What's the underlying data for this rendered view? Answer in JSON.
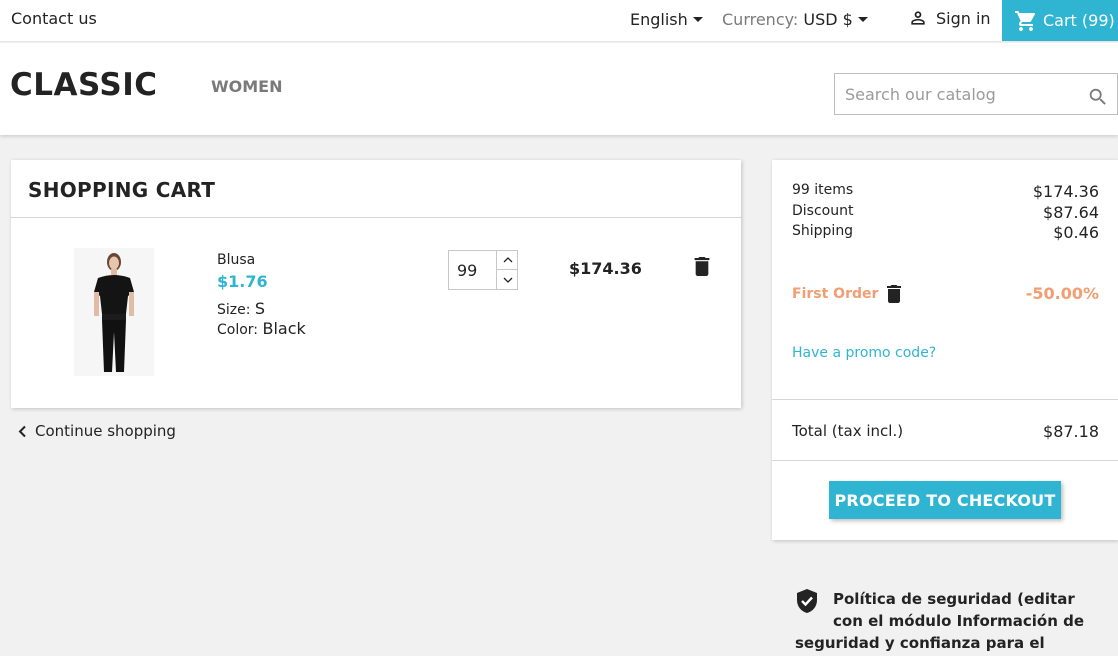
{
  "topnav": {
    "contact": "Contact us",
    "language": "English",
    "currency_label": "Currency:",
    "currency_value": "USD $",
    "signin": "Sign in",
    "cart": "Cart (99)"
  },
  "header": {
    "logo": "CLASSIC",
    "menu_women": "WOMEN",
    "search_placeholder": "Search our catalog"
  },
  "cart": {
    "title": "SHOPPING CART",
    "item": {
      "name": "Blusa",
      "price": "$1.76",
      "size_label": "Size:",
      "size": "S",
      "color_label": "Color:",
      "color": "Black",
      "quantity": "99",
      "line_total": "$174.36"
    },
    "continue": "Continue shopping"
  },
  "summary": {
    "items_label": "99 items",
    "items_value": "$174.36",
    "discount_label": "Discount",
    "discount_value": "$87.64",
    "shipping_label": "Shipping",
    "shipping_value": "$0.46",
    "voucher_name": "First Order",
    "voucher_value": "-50.00%",
    "promo": "Have a promo code?",
    "total_label": "Total (tax incl.)",
    "total_value": "$87.18",
    "checkout": "PROCEED TO CHECKOUT"
  },
  "reassurance": {
    "text": "Política de seguridad (editar con el módulo Información de seguridad y confianza para el cliente)"
  },
  "colors": {
    "accent": "#2fb5d2",
    "voucher": "#f39d72",
    "text": "#232323",
    "muted": "#7a7a7a",
    "background": "#f1f1f1"
  },
  "icons": {
    "user": "user-icon",
    "cart": "shopping-cart-icon",
    "search": "search-icon",
    "delete": "trash-icon",
    "back": "chevron-left-icon",
    "shield": "shield-check-icon"
  }
}
